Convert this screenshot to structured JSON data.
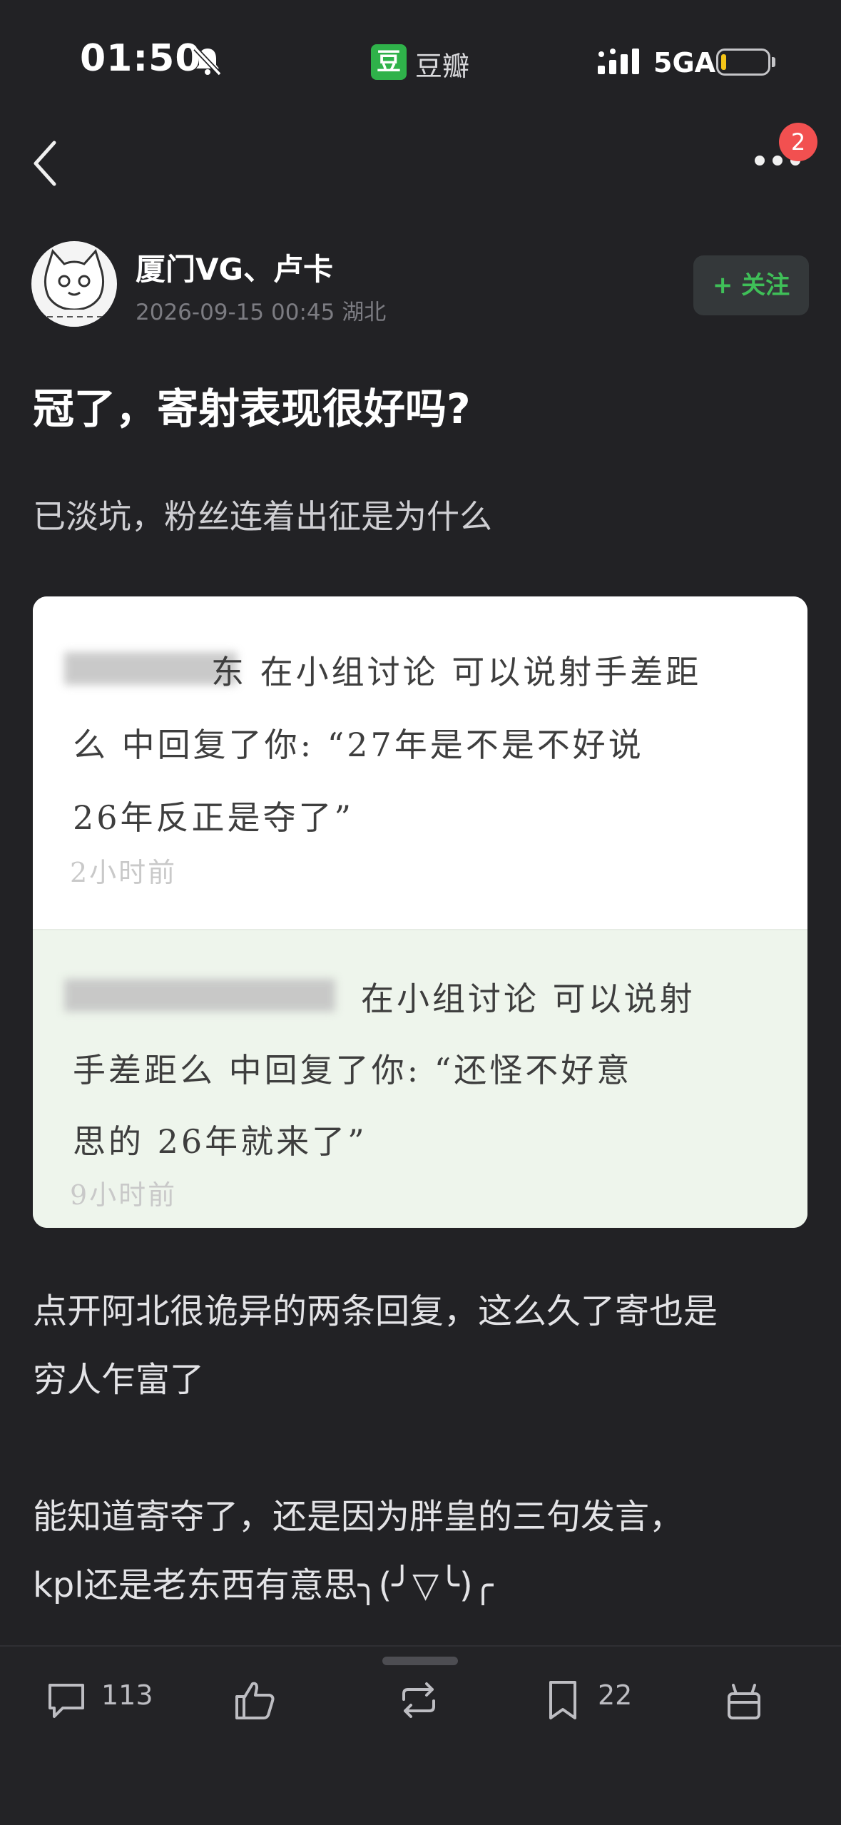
{
  "status_bar": {
    "time": "01:50",
    "app_badge": "豆",
    "app_name": "豆瓣",
    "network": "5GA"
  },
  "nav": {
    "more_badge": "2"
  },
  "post": {
    "author": "厦门VG、卢卡",
    "meta": "2026-09-15 00:45  湖北",
    "follow_label": "+ 关注",
    "title": "冠了，寄射表现很好吗?",
    "lead": "已淡坑，粉丝连着出征是为什么",
    "paragraph1_line1": "点开阿北很诡异的两条回复，这么久了寄也是",
    "paragraph1_line2": "穷人乍富了",
    "paragraph2_line1": "能知道寄夺了，还是因为胖皇的三句发言，",
    "paragraph2_line2": "kpl还是老东西有意思╮(╯▽╰)╭"
  },
  "image_card": {
    "reply1": {
      "line1": "东  在小组讨论 可以说射手差距",
      "line2": "么 中回复了你: “27年是不是不好说",
      "line3": "26年反正是夺了”",
      "time": "2小时前"
    },
    "reply2": {
      "line1": "在小组讨论 可以说射",
      "line2": "手差距么 中回复了你: “还怪不好意",
      "line3": "思的 26年就来了”",
      "time": "9小时前"
    }
  },
  "bottom_bar": {
    "comment_count": "113",
    "collect_count": "22"
  },
  "colors": {
    "background": "#222225",
    "accent_green": "#3fbf58",
    "badge_red": "#f25050"
  }
}
